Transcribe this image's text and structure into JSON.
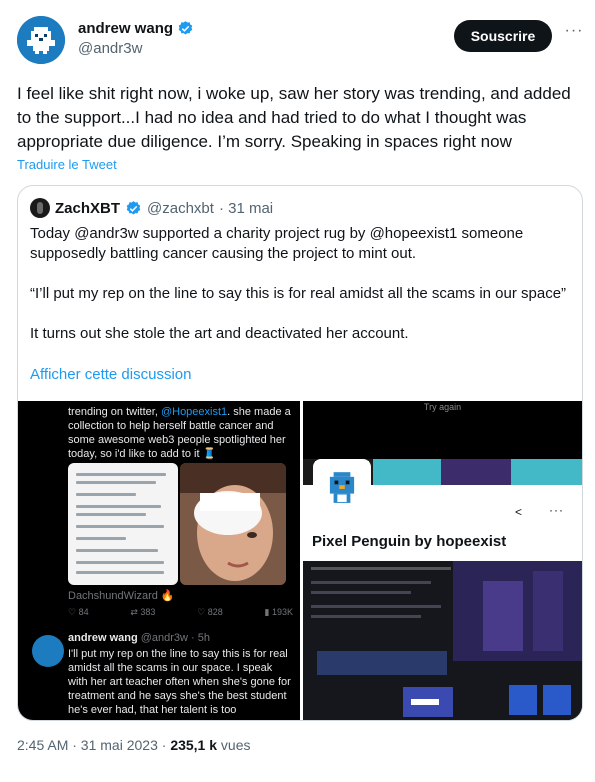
{
  "author": {
    "display_name": "andrew wang",
    "handle": "@andr3w",
    "subscribe_label": "Souscrire",
    "more_label": "···"
  },
  "tweet": {
    "text": "I feel like shit right now, i woke up, saw her story was trending, and added to the support...I had no idea and had tried to do what I thought was appropriate due diligence. I’m sorry. Speaking in spaces right now",
    "translate_label": "Traduire le Tweet"
  },
  "quote": {
    "display_name": "ZachXBT",
    "handle": "@zachxbt",
    "date": "· 31 mai",
    "paragraphs": [
      "Today @andr3w supported a charity project rug by @hopeexist1 someone supposedly battling cancer causing the project to mint out.",
      "“I’ll put my rep on the line to say this is for real amidst all the scams in our space”",
      "It turns out she stole the art and deactivated her account."
    ],
    "show_thread_label": "Afficher cette discussion"
  },
  "media_left": {
    "line1": "trending on twitter,",
    "mention": "@Hopeexist1",
    "line1_rest": ". she made a collection to help herself battle cancer and some awesome web3 people spotlighted her today, so i'd like to add to it 🧵",
    "author": "DachshundWizard 🔥",
    "stats": [
      "84",
      "383",
      "828",
      "193K"
    ],
    "reply_name": "andrew wang",
    "reply_handle": "@andr3w · 5h",
    "reply_text": "I'll put my rep on the line to say this is for real amidst all the scams in our space. I speak with her art teacher often when she's gone for treatment and he says she's the best student he's ever had, that her talent is too"
  },
  "media_right": {
    "try_again": "Try again",
    "title": "Pixel Penguin by hopeexist"
  },
  "footer": {
    "time": "2:45 AM · 31 mai 2023 ·",
    "views": "235,1 k",
    "views_label": "vues"
  },
  "colors": {
    "accent": "#1d9bf0",
    "button_bg": "#0f1419",
    "muted": "#536471"
  }
}
